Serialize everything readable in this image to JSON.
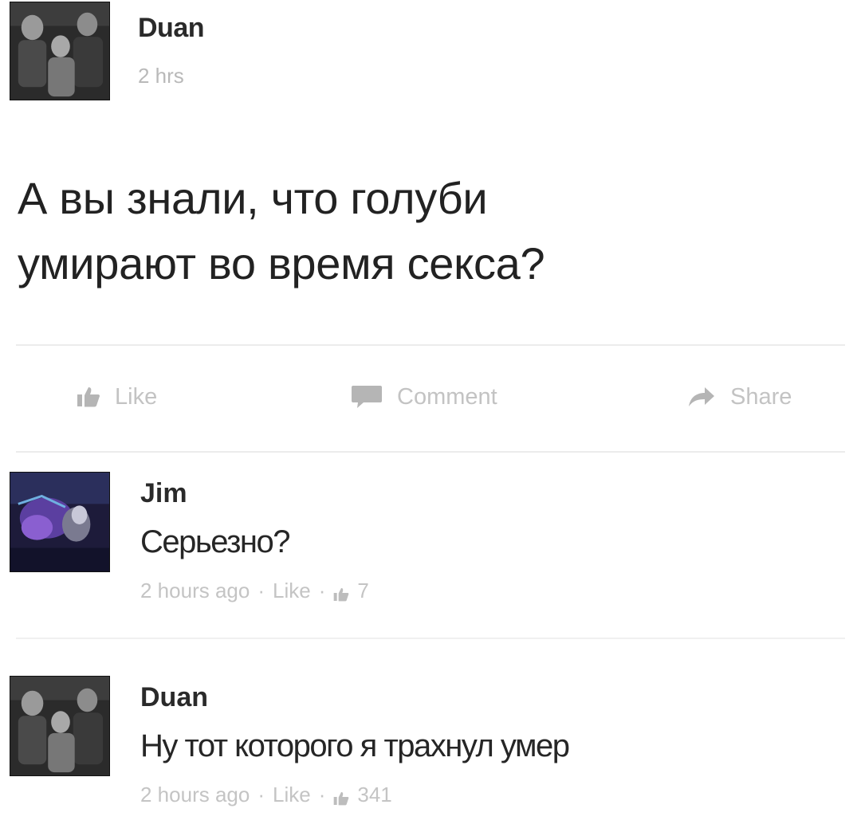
{
  "post": {
    "author": "Duan",
    "time": "2 hrs",
    "text_line1": "А вы знали, что голуби",
    "text_line2": "умирают во время секса?"
  },
  "actions": {
    "like_label": "Like",
    "comment_label": "Comment",
    "share_label": "Share"
  },
  "comments": [
    {
      "author": "Jim",
      "text": "Серьезно?",
      "time": "2 hours ago",
      "like_label": "Like",
      "likes": "7"
    },
    {
      "author": "Duan",
      "text": "Ну тот которого я трахнул умер",
      "time": "2 hours ago",
      "like_label": "Like",
      "likes": "341"
    }
  ],
  "icons": {
    "like": "thumbs-up-icon",
    "comment": "speech-bubble-icon",
    "share": "share-arrow-icon"
  },
  "colors": {
    "text": "#222222",
    "muted": "#c3c3c3",
    "avatar_dark": "#2a2a2a",
    "avatar_purple": "#5b3fa0"
  }
}
